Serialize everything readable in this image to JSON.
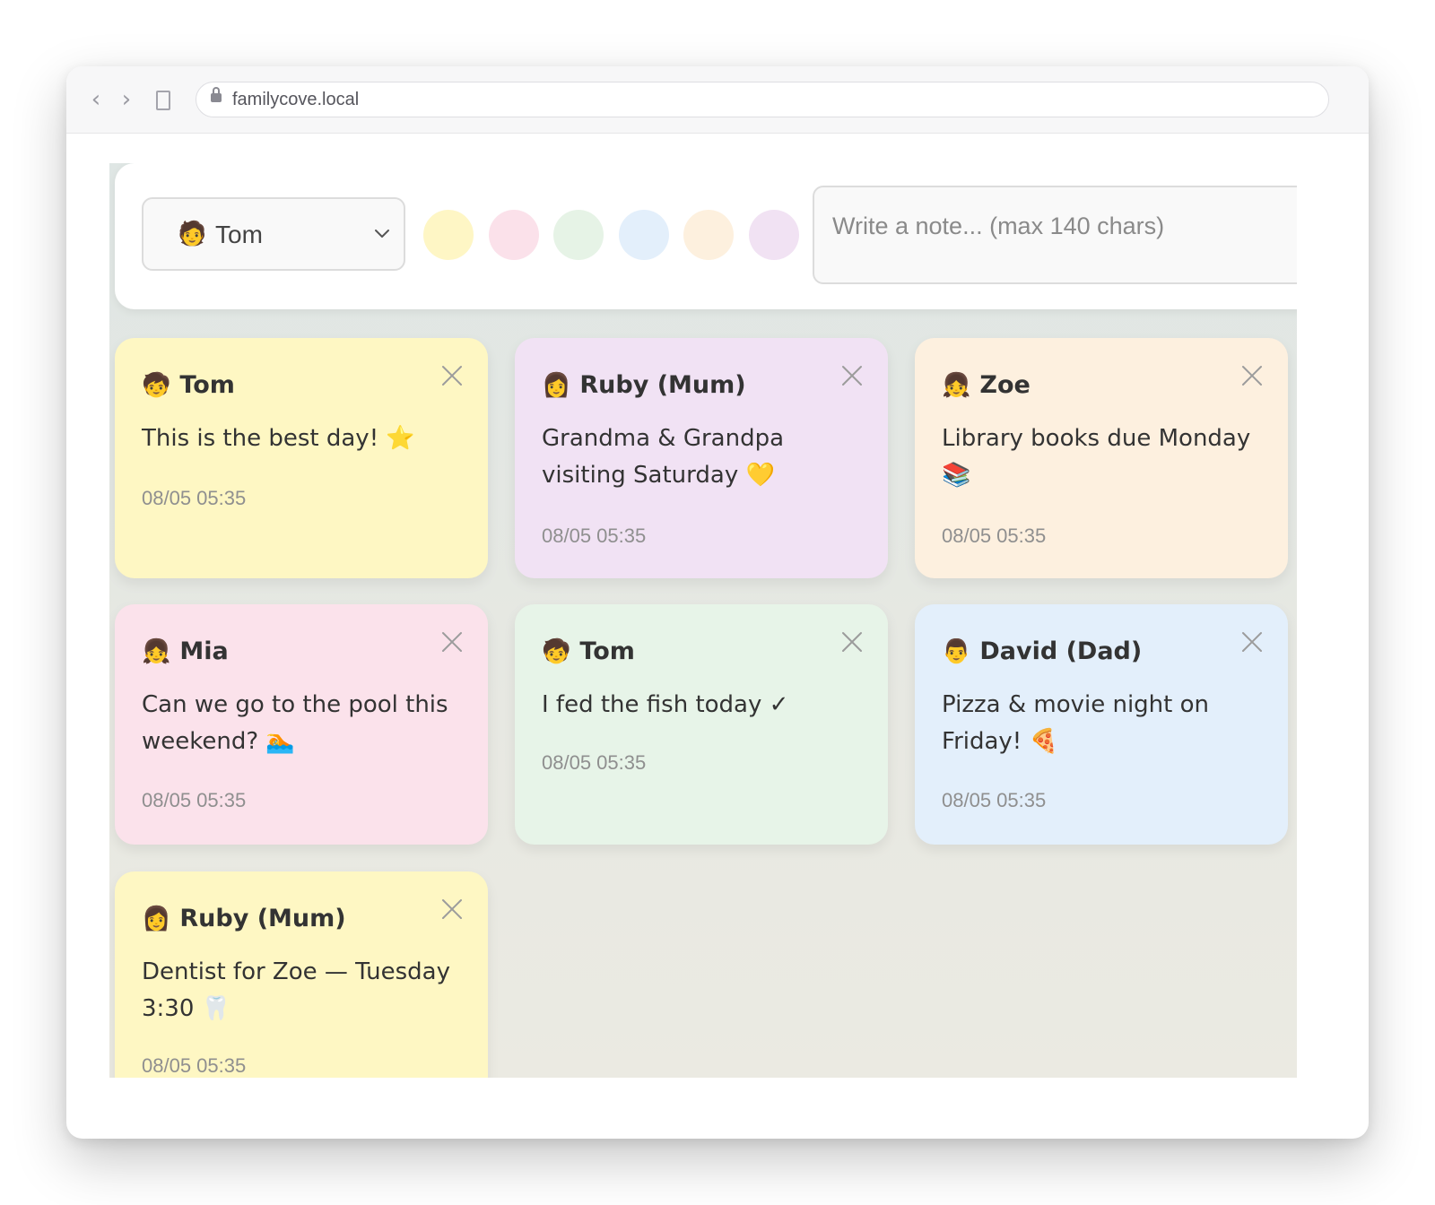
{
  "browser": {
    "url": "familycove.local",
    "back_glyph": "‹",
    "forward_glyph": "›"
  },
  "composer": {
    "selected_author": {
      "emoji": "🧑",
      "name": "Tom"
    },
    "colors": [
      "#fef6c5",
      "#fbe1ea",
      "#e6f3e6",
      "#e3effb",
      "#fdf0de",
      "#f1e2f3"
    ],
    "placeholder": "Write a note... (max 140 chars)",
    "value": ""
  },
  "notes": [
    {
      "emoji": "🧒",
      "author": "Tom",
      "text": "This is the best day! ⭐",
      "time": "08/05 05:35",
      "color": "#fef7c3"
    },
    {
      "emoji": "👩",
      "author": "Ruby (Mum)",
      "text": "Grandma & Grandpa visiting Saturday 💛",
      "time": "08/05 05:35",
      "color": "#f1e2f4"
    },
    {
      "emoji": "👧",
      "author": "Zoe",
      "text": "Library books due Monday 📚",
      "time": "08/05 05:35",
      "color": "#fdf0df"
    },
    {
      "emoji": "👧",
      "author": "Mia",
      "text": "Can we go to the pool this weekend? 🏊",
      "time": "08/05 05:35",
      "color": "#fbe2eb"
    },
    {
      "emoji": "🧒",
      "author": "Tom",
      "text": "I fed the fish today ✓",
      "time": "08/05 05:35",
      "color": "#e7f4e8"
    },
    {
      "emoji": "👨",
      "author": "David (Dad)",
      "text": "Pizza & movie night on Friday! 🍕",
      "time": "08/05 05:35",
      "color": "#e3effb"
    },
    {
      "emoji": "👩",
      "author": "Ruby (Mum)",
      "text": "Dentist for Zoe — Tuesday 3:30 🦷",
      "time": "08/05 05:35",
      "color": "#fef7c3"
    }
  ]
}
